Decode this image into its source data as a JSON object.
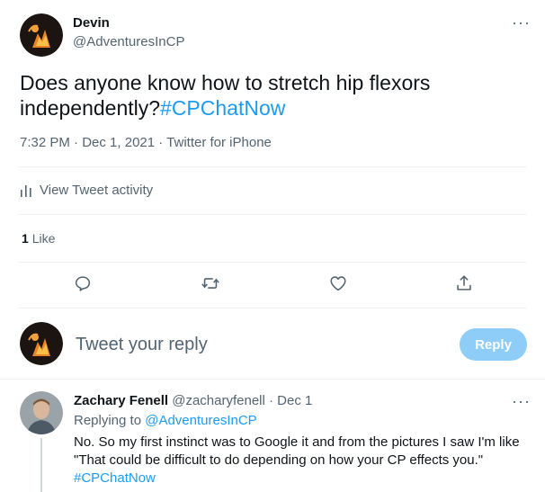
{
  "tweet": {
    "author_name": "Devin",
    "author_handle": "@AdventuresInCP",
    "text": "Does anyone know how to stretch hip flexors independently?",
    "hashtag": "#CPChatNow",
    "time": "7:32 PM",
    "separator": " · ",
    "date": "Dec 1, 2021",
    "source": "Twitter for iPhone",
    "activity_label": "View Tweet activity",
    "likes_count": "1",
    "likes_label": "Like"
  },
  "compose": {
    "placeholder": "Tweet your reply",
    "reply_button": "Reply"
  },
  "reply": {
    "author_name": "Zachary Fenell",
    "author_handle": "@zacharyfenell",
    "separator": " · ",
    "date": "Dec 1",
    "replying_to_prefix": "Replying to ",
    "replying_to_handle": "@AdventuresInCP",
    "text": "No. So my first instinct was to Google it and from the pictures I saw I'm like \"That could be difficult to do depending on how your CP effects you.\"",
    "hashtag": "#CPChatNow"
  },
  "icons": {
    "more": "more-icon",
    "activity": "bar-chart-icon",
    "reply": "reply-icon",
    "retweet": "retweet-icon",
    "like": "heart-icon",
    "share": "share-icon"
  },
  "colors": {
    "accent": "#1d9bf0",
    "reply_button_disabled": "#8ecdf8",
    "muted_text": "#536471",
    "divider": "#eff3f4"
  }
}
